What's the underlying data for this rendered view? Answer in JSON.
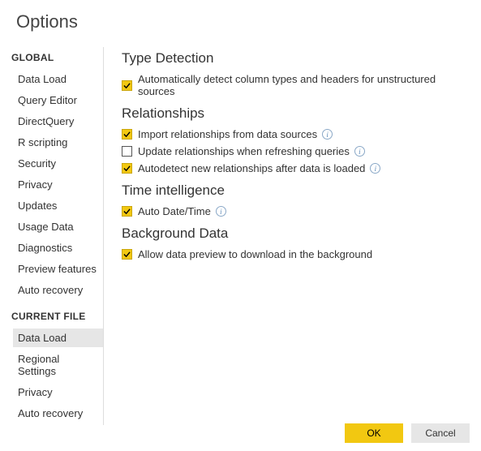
{
  "title": "Options",
  "sidebar": {
    "global_label": "GLOBAL",
    "current_file_label": "CURRENT FILE",
    "global_items": [
      "Data Load",
      "Query Editor",
      "DirectQuery",
      "R scripting",
      "Security",
      "Privacy",
      "Updates",
      "Usage Data",
      "Diagnostics",
      "Preview features",
      "Auto recovery"
    ],
    "current_file_items": [
      "Data Load",
      "Regional Settings",
      "Privacy",
      "Auto recovery"
    ],
    "selected": "cf-0"
  },
  "groups": {
    "type_detection": {
      "heading": "Type Detection",
      "opt0": {
        "label": "Automatically detect column types and headers for unstructured sources",
        "checked": true,
        "info": false
      }
    },
    "relationships": {
      "heading": "Relationships",
      "opt0": {
        "label": "Import relationships from data sources",
        "checked": true,
        "info": true
      },
      "opt1": {
        "label": "Update relationships when refreshing queries",
        "checked": false,
        "info": true
      },
      "opt2": {
        "label": "Autodetect new relationships after data is loaded",
        "checked": true,
        "info": true
      }
    },
    "time_intelligence": {
      "heading": "Time intelligence",
      "opt0": {
        "label": "Auto Date/Time",
        "checked": true,
        "info": true
      }
    },
    "background_data": {
      "heading": "Background Data",
      "opt0": {
        "label": "Allow data preview to download in the background",
        "checked": true,
        "info": false
      }
    }
  },
  "buttons": {
    "ok": "OK",
    "cancel": "Cancel"
  }
}
